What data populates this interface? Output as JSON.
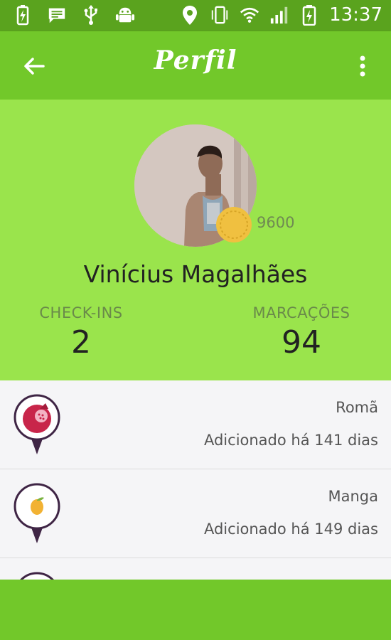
{
  "status_bar": {
    "time": "13:37",
    "icons": [
      "battery-charging-icon",
      "message-icon",
      "usb-icon",
      "android-debug-icon",
      "location-icon",
      "vibrate-icon",
      "wifi-icon",
      "signal-icon",
      "battery-icon"
    ]
  },
  "app_bar": {
    "title": "Perfil",
    "back_icon": "arrow-back-icon",
    "menu_icon": "more-vert-icon"
  },
  "profile": {
    "name": "Vinícius Magalhães",
    "coins": "9600",
    "stats": {
      "checkins_label": "CHECK-INS",
      "checkins_value": "2",
      "marcacoes_label": "MARCAÇÕES",
      "marcacoes_value": "94"
    }
  },
  "items": [
    {
      "name": "Romã",
      "subtitle": "Adicionado há 141 dias",
      "icon": "pomegranate-icon"
    },
    {
      "name": "Manga",
      "subtitle": "Adicionado há 149 dias",
      "icon": "mango-icon"
    }
  ],
  "colors": {
    "status_bar": "#5aa31e",
    "app_bar": "#72c82a",
    "profile_bg": "#9ae44c",
    "pin": "#3f2545",
    "coin": "#f0c040"
  }
}
